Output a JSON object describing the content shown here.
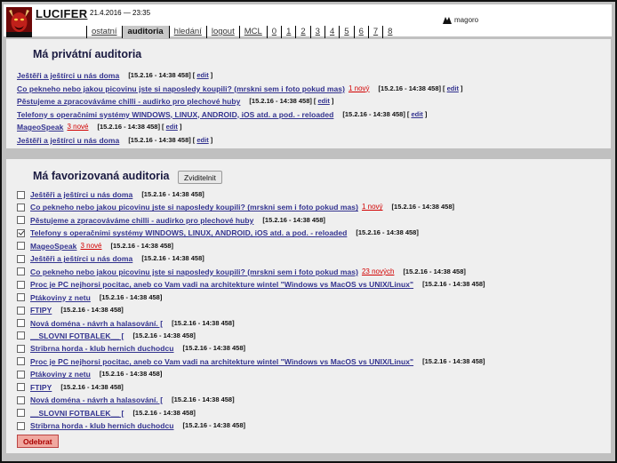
{
  "header": {
    "site_title": "LUCIFER",
    "datetime": "21.4.2016 — 23:35",
    "brand": "magoro",
    "nav": [
      "ostatní",
      "auditoria",
      "hledání",
      "logout",
      "MCL",
      "0",
      "1",
      "2",
      "3",
      "4",
      "5",
      "6",
      "7",
      "8"
    ],
    "active_nav": "auditoria"
  },
  "private": {
    "heading": "Má privátní auditoria",
    "edit_label": "edit",
    "items": [
      {
        "title": "Ještěři a ještírci u nás doma",
        "new": "",
        "stamp": "[15.2.16 - 14:38 458]"
      },
      {
        "title": "Co pekneho nebo jakou picovinu jste si naposledy koupili? (mrskni sem i foto pokud mas)",
        "new": "1 nový",
        "stamp": "[15.2.16 - 14:38 458]"
      },
      {
        "title": "Pěstujeme a zpracováváme chilli - audirko pro plechové huby",
        "new": "",
        "stamp": "[15.2.16 - 14:38 458]"
      },
      {
        "title": "Telefony s operačními systémy WINDOWS, LINUX, ANDROID, iOS atd. a pod. - reloaded",
        "new": "",
        "stamp": "[15.2.16 - 14:38 458]"
      },
      {
        "title": "MageoSpeak",
        "new": "3 nové",
        "stamp": "[15.2.16 - 14:38 458]"
      },
      {
        "title": "Ještěři a ještírci u nás doma",
        "new": "",
        "stamp": "[15.2.16 - 14:38 458]"
      }
    ]
  },
  "favorites": {
    "heading": "Má favorizovaná auditoria",
    "visibility_button": "Zviditelnit",
    "remove_button": "Odebrat",
    "items": [
      {
        "title": "Ještěři a ještírci u nás doma",
        "new": "",
        "stamp": "[15.2.16 - 14:38 458]",
        "checked": false
      },
      {
        "title": "Co pekneho nebo jakou picovinu jste si naposledy koupili? (mrskni sem i foto pokud mas)",
        "new": "1 nový",
        "stamp": "[15.2.16 - 14:38 458]",
        "checked": false
      },
      {
        "title": "Pěstujeme a zpracováváme chilli - audirko pro plechové huby",
        "new": "",
        "stamp": "[15.2.16 - 14:38 458]",
        "checked": false
      },
      {
        "title": "Telefony s operačními systémy WINDOWS, LINUX, ANDROID, iOS atd. a pod. - reloaded",
        "new": "",
        "stamp": "[15.2.16 - 14:38 458]",
        "checked": true
      },
      {
        "title": "MageoSpeak",
        "new": "3 nové",
        "stamp": "[15.2.16 - 14:38 458]",
        "checked": false
      },
      {
        "title": "Ještěři a ještírci u nás doma",
        "new": "",
        "stamp": "[15.2.16 - 14:38 458]",
        "checked": false
      },
      {
        "title": "Co pekneho nebo jakou picovinu jste si naposledy koupili? (mrskni sem i foto pokud mas)",
        "new": "23 nových",
        "stamp": "[15.2.16 - 14:38 458]",
        "checked": false
      },
      {
        "title": "Proc je PC nejhorsi pocitac, aneb co Vam vadi na architekture wintel \"Windows vs MacOS vs UNIX/Linux\"",
        "new": "",
        "stamp": "[15.2.16 - 14:38 458]",
        "checked": false
      },
      {
        "title": "Ptákoviny z netu",
        "new": "",
        "stamp": "[15.2.16 - 14:38 458]",
        "checked": false
      },
      {
        "title": "FTIPY",
        "new": "",
        "stamp": "[15.2.16 - 14:38 458]",
        "checked": false
      },
      {
        "title": "Nová doména - návrh a halasování. [",
        "new": "",
        "stamp": "[15.2.16 - 14:38 458]",
        "checked": false
      },
      {
        "title": "__SLOVNI FOTBALEK__ [",
        "new": "",
        "stamp": "[15.2.16 - 14:38 458]",
        "checked": false
      },
      {
        "title": "Stribrna horda - klub hernich duchodcu",
        "new": "",
        "stamp": "[15.2.16 - 14:38 458]",
        "checked": false
      },
      {
        "title": "Proc je PC nejhorsi pocitac, aneb co Vam vadi na architekture wintel \"Windows vs MacOS vs UNIX/Linux\"",
        "new": "",
        "stamp": "[15.2.16 - 14:38 458]",
        "checked": false
      },
      {
        "title": "Ptákoviny z netu",
        "new": "",
        "stamp": "[15.2.16 - 14:38 458]",
        "checked": false
      },
      {
        "title": "FTIPY",
        "new": "",
        "stamp": "[15.2.16 - 14:38 458]",
        "checked": false
      },
      {
        "title": "Nová doména - návrh a halasování. [",
        "new": "",
        "stamp": "[15.2.16 - 14:38 458]",
        "checked": false
      },
      {
        "title": "__SLOVNI FOTBALEK__ [",
        "new": "",
        "stamp": "[15.2.16 - 14:38 458]",
        "checked": false
      },
      {
        "title": "Stribrna horda - klub hernich duchodcu",
        "new": "",
        "stamp": "[15.2.16 - 14:38 458]",
        "checked": false
      }
    ]
  }
}
